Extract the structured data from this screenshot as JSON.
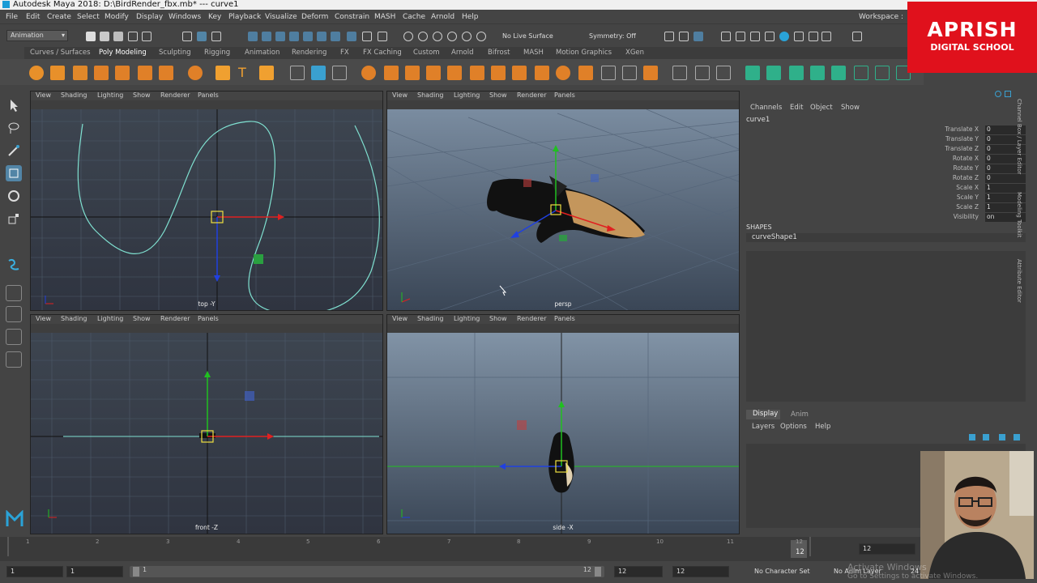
{
  "window": {
    "title": "Autodesk Maya 2018: D:\\BirdRender_fbx.mb*   ---   curve1"
  },
  "menubar": {
    "items": [
      "File",
      "Edit",
      "Create",
      "Select",
      "Modify",
      "Display",
      "Windows",
      "Key",
      "Playback",
      "Visualize",
      "Deform",
      "Constrain",
      "MASH",
      "Cache",
      "Arnold",
      "Help"
    ],
    "workspace_label": "Workspace :"
  },
  "statusline": {
    "menuset": "Animation",
    "live_surface": "No Live Surface",
    "symmetry": "Symmetry: Off"
  },
  "shelf": {
    "tabs": [
      "Curves / Surfaces",
      "Poly Modeling",
      "Sculpting",
      "Rigging",
      "Animation",
      "Rendering",
      "FX",
      "FX Caching",
      "Custom",
      "Arnold",
      "Bifrost",
      "MASH",
      "Motion Graphics",
      "XGen"
    ],
    "active_tab": "Poly Modeling"
  },
  "viewport_menu": [
    "View",
    "Shading",
    "Lighting",
    "Show",
    "Renderer",
    "Panels"
  ],
  "viewports": {
    "top": {
      "label": "top -Y"
    },
    "persp": {
      "label": "persp"
    },
    "front": {
      "label": "front -Z"
    },
    "side": {
      "label": "side -X"
    }
  },
  "channelbox": {
    "menu": [
      "Channels",
      "Edit",
      "Object",
      "Show"
    ],
    "object_name": "curve1",
    "attributes": [
      {
        "name": "Translate X",
        "value": "0"
      },
      {
        "name": "Translate Y",
        "value": "0"
      },
      {
        "name": "Translate Z",
        "value": "0"
      },
      {
        "name": "Rotate X",
        "value": "0"
      },
      {
        "name": "Rotate Y",
        "value": "0"
      },
      {
        "name": "Rotate Z",
        "value": "0"
      },
      {
        "name": "Scale X",
        "value": "1"
      },
      {
        "name": "Scale Y",
        "value": "1"
      },
      {
        "name": "Scale Z",
        "value": "1"
      },
      {
        "name": "Visibility",
        "value": "on"
      }
    ],
    "shapes_header": "SHAPES",
    "shape_name": "curveShape1",
    "side_tabs": [
      "Channel Box / Layer Editor",
      "Modeling Toolkit",
      "Attribute Editor"
    ]
  },
  "layer_editor": {
    "tabs": [
      "Display",
      "Anim"
    ],
    "active_tab": "Display",
    "menu": [
      "Layers",
      "Options",
      "Help"
    ]
  },
  "timeslider": {
    "ticks": [
      "1",
      "2",
      "3",
      "4",
      "5",
      "6",
      "7",
      "8",
      "9",
      "10",
      "11",
      "12"
    ],
    "current_frame": "12",
    "current_frame_field": "12"
  },
  "rangeslider": {
    "start_frame": "1",
    "range_start": "1",
    "range_handle_start": "1",
    "range_handle_end": "12",
    "range_end": "12",
    "end_frame": "12",
    "character_set": "No Character Set",
    "anim_layer": "No Anim Layer",
    "fps": "24"
  },
  "overlay": {
    "brand_line1": "APRISH",
    "brand_line2": "DIGITAL SCHOOL",
    "watermark": "Activate Windows",
    "watermark_sub": "Go to Settings to activate Windows."
  },
  "colors": {
    "accent_blue": "#5285a6",
    "axis_red": "#e02020",
    "axis_green": "#20c020",
    "axis_blue": "#2040e0",
    "curve_cyan": "#7fe0d0",
    "brand_red": "#e0111c"
  }
}
